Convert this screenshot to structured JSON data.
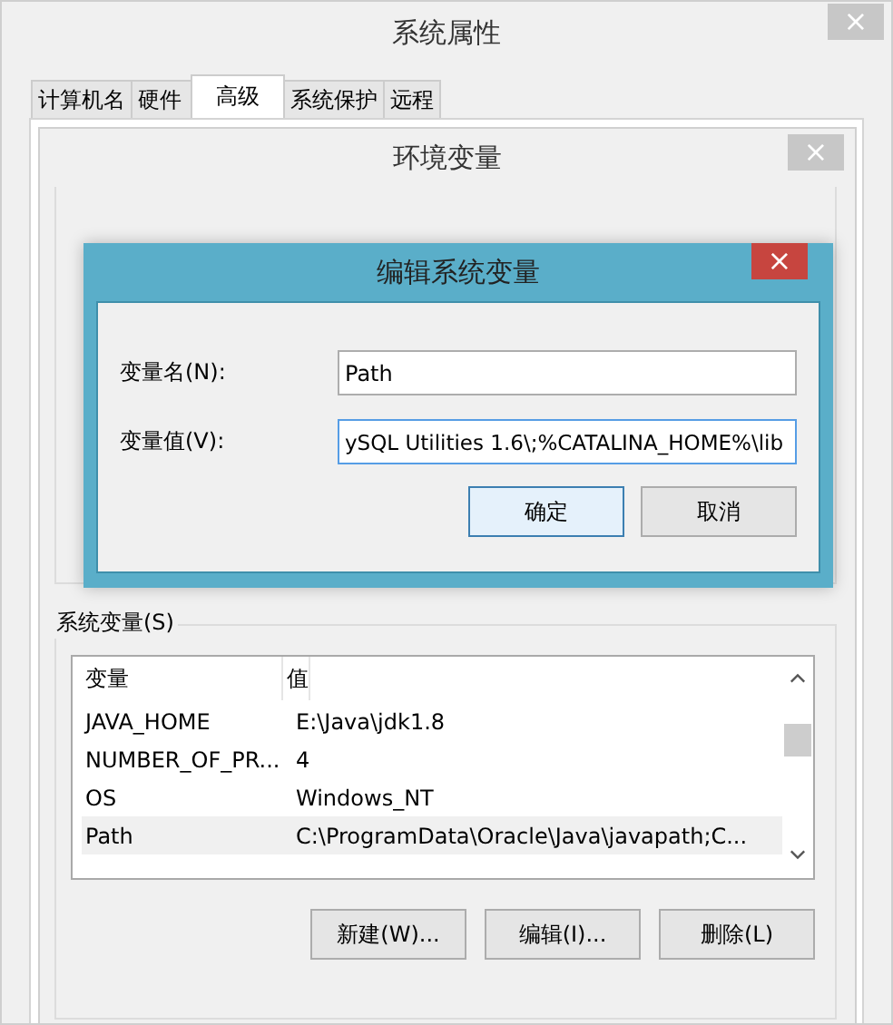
{
  "window": {
    "title": "系统属性",
    "close": "×"
  },
  "tabs": [
    {
      "label": "计算机名",
      "selected": false
    },
    {
      "label": "硬件",
      "selected": false
    },
    {
      "label": "高级",
      "selected": true
    },
    {
      "label": "系统保护",
      "selected": false
    },
    {
      "label": "远程",
      "selected": false
    }
  ],
  "env_dialog": {
    "title": "环境变量",
    "close": "×",
    "system_vars": {
      "label": "系统变量(S)",
      "columns": [
        "变量",
        "值"
      ],
      "rows": [
        {
          "name": "JAVA_HOME",
          "value": "E:\\Java\\jdk1.8",
          "selected": false
        },
        {
          "name": "NUMBER_OF_PR...",
          "value": "4",
          "selected": false
        },
        {
          "name": "OS",
          "value": "Windows_NT",
          "selected": false
        },
        {
          "name": "Path",
          "value": "C:\\ProgramData\\Oracle\\Java\\javapath;C...",
          "selected": true
        }
      ],
      "buttons": [
        "新建(W)...",
        "编辑(I)...",
        "删除(L)"
      ]
    }
  },
  "edit_dialog": {
    "title": "编辑系统变量",
    "close": "×",
    "fields": [
      {
        "label": "变量名(N):",
        "value": "Path",
        "focused": false
      },
      {
        "label": "变量值(V):",
        "value": "ySQL Utilities 1.6\\;%CATALINA_HOME%\\lib",
        "focused": true
      }
    ],
    "buttons": [
      {
        "label": "确定",
        "default": true
      },
      {
        "label": "取消",
        "default": false
      }
    ]
  }
}
